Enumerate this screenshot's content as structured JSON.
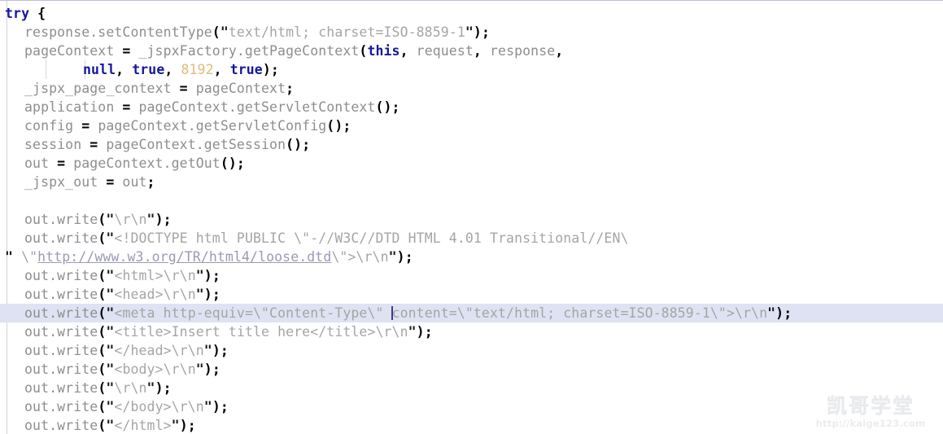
{
  "editor": {
    "language": "jsp-java",
    "theme": "eclipse-light",
    "current_line_index": 17,
    "caret_line_index": 17,
    "colors": {
      "background": "#ffffff",
      "keyword": "#16189c",
      "punctuation": "#000000",
      "identifier": "#8e8e8e",
      "string": "#a5a5a5",
      "string_quote": "#1a1a1a",
      "number": "#e5b87a",
      "link": "#9a9ab5",
      "current_line_highlight": "#dfe2f2",
      "indent_guide": "#d2d2dd",
      "caret": "#3a3a8c",
      "top_border": "#b9c0d6"
    }
  },
  "code": {
    "lines": [
      {
        "index": 0,
        "indent": 0,
        "tokens": [
          {
            "t": "try",
            "k": "kw"
          },
          {
            "t": " ",
            "k": "ident"
          },
          {
            "t": "{",
            "k": "punc"
          }
        ]
      },
      {
        "index": 1,
        "indent": 1,
        "tokens": [
          {
            "t": "response.setContentType",
            "k": "ident"
          },
          {
            "t": "(",
            "k": "punc"
          },
          {
            "t": "\"",
            "k": "quote"
          },
          {
            "t": "text/html; charset=ISO-8859-1",
            "k": "str"
          },
          {
            "t": "\"",
            "k": "quote"
          },
          {
            "t": ")",
            "k": "punc"
          },
          {
            "t": ";",
            "k": "punc"
          }
        ]
      },
      {
        "index": 2,
        "indent": 1,
        "tokens": [
          {
            "t": "pageContext ",
            "k": "ident"
          },
          {
            "t": "=",
            "k": "punc"
          },
          {
            "t": " _jspxFactory.getPageContext",
            "k": "ident"
          },
          {
            "t": "(",
            "k": "punc"
          },
          {
            "t": "this",
            "k": "kw"
          },
          {
            "t": ",",
            "k": "punc"
          },
          {
            "t": " request",
            "k": "ident"
          },
          {
            "t": ",",
            "k": "punc"
          },
          {
            "t": " response",
            "k": "ident"
          },
          {
            "t": ",",
            "k": "punc"
          }
        ]
      },
      {
        "index": 3,
        "indent": 4,
        "tokens": [
          {
            "t": "null",
            "k": "kw"
          },
          {
            "t": ",",
            "k": "punc"
          },
          {
            "t": " ",
            "k": "ident"
          },
          {
            "t": "true",
            "k": "kw"
          },
          {
            "t": ",",
            "k": "punc"
          },
          {
            "t": " ",
            "k": "ident"
          },
          {
            "t": "8192",
            "k": "num"
          },
          {
            "t": ",",
            "k": "punc"
          },
          {
            "t": " ",
            "k": "ident"
          },
          {
            "t": "true",
            "k": "kw"
          },
          {
            "t": ")",
            "k": "punc"
          },
          {
            "t": ";",
            "k": "punc"
          }
        ]
      },
      {
        "index": 4,
        "indent": 1,
        "tokens": [
          {
            "t": "_jspx_page_context ",
            "k": "ident"
          },
          {
            "t": "=",
            "k": "punc"
          },
          {
            "t": " pageContext",
            "k": "ident"
          },
          {
            "t": ";",
            "k": "punc"
          }
        ]
      },
      {
        "index": 5,
        "indent": 1,
        "tokens": [
          {
            "t": "application ",
            "k": "ident"
          },
          {
            "t": "=",
            "k": "punc"
          },
          {
            "t": " pageContext.getServletContext",
            "k": "ident"
          },
          {
            "t": "()",
            "k": "punc"
          },
          {
            "t": ";",
            "k": "punc"
          }
        ]
      },
      {
        "index": 6,
        "indent": 1,
        "tokens": [
          {
            "t": "config ",
            "k": "ident"
          },
          {
            "t": "=",
            "k": "punc"
          },
          {
            "t": " pageContext.getServletConfig",
            "k": "ident"
          },
          {
            "t": "()",
            "k": "punc"
          },
          {
            "t": ";",
            "k": "punc"
          }
        ]
      },
      {
        "index": 7,
        "indent": 1,
        "tokens": [
          {
            "t": "session ",
            "k": "ident"
          },
          {
            "t": "=",
            "k": "punc"
          },
          {
            "t": " pageContext.getSession",
            "k": "ident"
          },
          {
            "t": "()",
            "k": "punc"
          },
          {
            "t": ";",
            "k": "punc"
          }
        ]
      },
      {
        "index": 8,
        "indent": 1,
        "tokens": [
          {
            "t": "out ",
            "k": "ident"
          },
          {
            "t": "=",
            "k": "punc"
          },
          {
            "t": " pageContext.getOut",
            "k": "ident"
          },
          {
            "t": "()",
            "k": "punc"
          },
          {
            "t": ";",
            "k": "punc"
          }
        ]
      },
      {
        "index": 9,
        "indent": 1,
        "tokens": [
          {
            "t": "_jspx_out ",
            "k": "ident"
          },
          {
            "t": "=",
            "k": "punc"
          },
          {
            "t": " out",
            "k": "ident"
          },
          {
            "t": ";",
            "k": "punc"
          }
        ]
      },
      {
        "index": 10,
        "indent": 0,
        "tokens": []
      },
      {
        "index": 11,
        "indent": 1,
        "tokens": [
          {
            "t": "out.write",
            "k": "ident"
          },
          {
            "t": "(",
            "k": "punc"
          },
          {
            "t": "\"",
            "k": "quote"
          },
          {
            "t": "\\r\\n",
            "k": "str"
          },
          {
            "t": "\"",
            "k": "quote"
          },
          {
            "t": ")",
            "k": "punc"
          },
          {
            "t": ";",
            "k": "punc"
          }
        ]
      },
      {
        "index": 12,
        "indent": 1,
        "tokens": [
          {
            "t": "out.write",
            "k": "ident"
          },
          {
            "t": "(",
            "k": "punc"
          },
          {
            "t": "\"",
            "k": "quote"
          },
          {
            "t": "<!DOCTYPE html PUBLIC \\\"-//W3C//DTD HTML 4.01 Transitional//EN\\",
            "k": "str"
          }
        ]
      },
      {
        "index": 13,
        "indent": 0,
        "tokens": [
          {
            "t": "\"",
            "k": "quote"
          },
          {
            "t": " \\\"",
            "k": "str"
          },
          {
            "t": "http://www.w3.org/TR/html4/loose.dtd",
            "k": "link"
          },
          {
            "t": "\\\">\\r\\n",
            "k": "str"
          },
          {
            "t": "\"",
            "k": "quote"
          },
          {
            "t": ")",
            "k": "punc"
          },
          {
            "t": ";",
            "k": "punc"
          }
        ]
      },
      {
        "index": 14,
        "indent": 1,
        "tokens": [
          {
            "t": "out.write",
            "k": "ident"
          },
          {
            "t": "(",
            "k": "punc"
          },
          {
            "t": "\"",
            "k": "quote"
          },
          {
            "t": "<html>\\r\\n",
            "k": "str"
          },
          {
            "t": "\"",
            "k": "quote"
          },
          {
            "t": ")",
            "k": "punc"
          },
          {
            "t": ";",
            "k": "punc"
          }
        ]
      },
      {
        "index": 15,
        "indent": 1,
        "tokens": [
          {
            "t": "out.write",
            "k": "ident"
          },
          {
            "t": "(",
            "k": "punc"
          },
          {
            "t": "\"",
            "k": "quote"
          },
          {
            "t": "<head>\\r\\n",
            "k": "str"
          },
          {
            "t": "\"",
            "k": "quote"
          },
          {
            "t": ")",
            "k": "punc"
          },
          {
            "t": ";",
            "k": "punc"
          }
        ]
      },
      {
        "index": 16,
        "indent": 1,
        "current": true,
        "tokens": [
          {
            "t": "out.write",
            "k": "ident"
          },
          {
            "t": "(",
            "k": "punc"
          },
          {
            "t": "\"",
            "k": "quote"
          },
          {
            "t": "<meta http-equiv=\\\"Content-Type\\\" ",
            "k": "str"
          },
          {
            "t": "",
            "k": "caret"
          },
          {
            "t": "content=\\\"text/html; charset=ISO-8859-1\\\">\\r\\n",
            "k": "str"
          },
          {
            "t": "\"",
            "k": "quote"
          },
          {
            "t": ")",
            "k": "punc"
          },
          {
            "t": ";",
            "k": "punc"
          }
        ]
      },
      {
        "index": 17,
        "indent": 1,
        "tokens": [
          {
            "t": "out.write",
            "k": "ident"
          },
          {
            "t": "(",
            "k": "punc"
          },
          {
            "t": "\"",
            "k": "quote"
          },
          {
            "t": "<title>Insert title here</title>\\r\\n",
            "k": "str"
          },
          {
            "t": "\"",
            "k": "quote"
          },
          {
            "t": ")",
            "k": "punc"
          },
          {
            "t": ";",
            "k": "punc"
          }
        ]
      },
      {
        "index": 18,
        "indent": 1,
        "tokens": [
          {
            "t": "out.write",
            "k": "ident"
          },
          {
            "t": "(",
            "k": "punc"
          },
          {
            "t": "\"",
            "k": "quote"
          },
          {
            "t": "</head>\\r\\n",
            "k": "str"
          },
          {
            "t": "\"",
            "k": "quote"
          },
          {
            "t": ")",
            "k": "punc"
          },
          {
            "t": ";",
            "k": "punc"
          }
        ]
      },
      {
        "index": 19,
        "indent": 1,
        "tokens": [
          {
            "t": "out.write",
            "k": "ident"
          },
          {
            "t": "(",
            "k": "punc"
          },
          {
            "t": "\"",
            "k": "quote"
          },
          {
            "t": "<body>\\r\\n",
            "k": "str"
          },
          {
            "t": "\"",
            "k": "quote"
          },
          {
            "t": ")",
            "k": "punc"
          },
          {
            "t": ";",
            "k": "punc"
          }
        ]
      },
      {
        "index": 20,
        "indent": 1,
        "tokens": [
          {
            "t": "out.write",
            "k": "ident"
          },
          {
            "t": "(",
            "k": "punc"
          },
          {
            "t": "\"",
            "k": "quote"
          },
          {
            "t": "\\r\\n",
            "k": "str"
          },
          {
            "t": "\"",
            "k": "quote"
          },
          {
            "t": ")",
            "k": "punc"
          },
          {
            "t": ";",
            "k": "punc"
          }
        ]
      },
      {
        "index": 21,
        "indent": 1,
        "tokens": [
          {
            "t": "out.write",
            "k": "ident"
          },
          {
            "t": "(",
            "k": "punc"
          },
          {
            "t": "\"",
            "k": "quote"
          },
          {
            "t": "</body>\\r\\n",
            "k": "str"
          },
          {
            "t": "\"",
            "k": "quote"
          },
          {
            "t": ")",
            "k": "punc"
          },
          {
            "t": ";",
            "k": "punc"
          }
        ]
      },
      {
        "index": 22,
        "indent": 1,
        "tokens": [
          {
            "t": "out.write",
            "k": "ident"
          },
          {
            "t": "(",
            "k": "punc"
          },
          {
            "t": "\"",
            "k": "quote"
          },
          {
            "t": "</html>",
            "k": "str"
          },
          {
            "t": "\"",
            "k": "quote"
          },
          {
            "t": ")",
            "k": "punc"
          },
          {
            "t": ";",
            "k": "punc"
          }
        ]
      }
    ]
  },
  "watermark": {
    "brand": "凯哥学堂",
    "url": "http://kaige123.com"
  }
}
